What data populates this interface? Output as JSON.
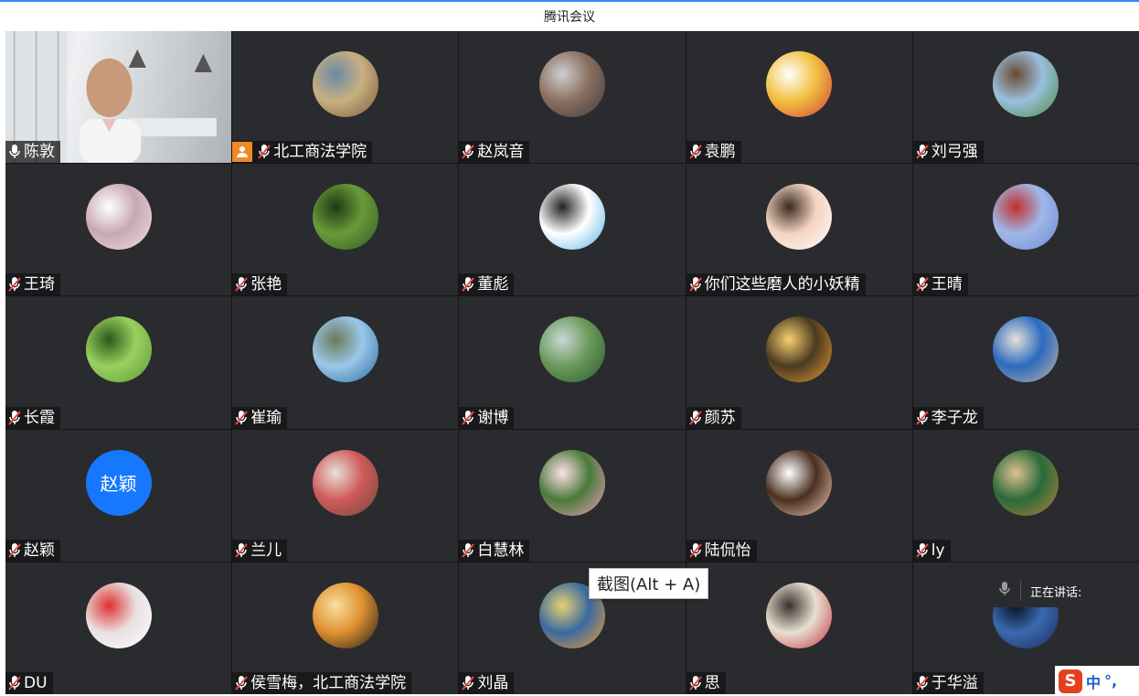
{
  "window": {
    "title": "腾讯会议"
  },
  "participants": [
    {
      "name": "陈敦",
      "kind": "video",
      "mic": "on"
    },
    {
      "name": "北工商法学院",
      "kind": "avatar",
      "host": true,
      "colors": [
        "#7a5a3a",
        "#c8b080",
        "#6a8aa8"
      ]
    },
    {
      "name": "赵岚音",
      "kind": "avatar",
      "colors": [
        "#3a3a3a",
        "#8a7060",
        "#cfcfcf"
      ]
    },
    {
      "name": "袁鹏",
      "kind": "avatar",
      "colors": [
        "#d23a3a",
        "#f2c040",
        "#ffffff"
      ]
    },
    {
      "name": "刘弓强",
      "kind": "avatar",
      "colors": [
        "#4a8a3a",
        "#9ac0e0",
        "#6b4a30"
      ]
    },
    {
      "name": "王琦",
      "kind": "avatar",
      "colors": [
        "#f0e0e4",
        "#c8a8b0",
        "#ffffff"
      ]
    },
    {
      "name": "张艳",
      "kind": "avatar",
      "colors": [
        "#2f5a22",
        "#6a9a3a",
        "#1c3a14"
      ]
    },
    {
      "name": "董彪",
      "kind": "avatar",
      "colors": [
        "#58b0e8",
        "#ffffff",
        "#222222"
      ]
    },
    {
      "name": "你们这些磨人的小妖精",
      "kind": "avatar",
      "colors": [
        "#ffffff",
        "#f4d4c0",
        "#3a2a20"
      ]
    },
    {
      "name": "王晴",
      "kind": "avatar",
      "colors": [
        "#6a8ad0",
        "#a0b8e8",
        "#c03030"
      ]
    },
    {
      "name": "长霞",
      "kind": "avatar",
      "colors": [
        "#5a9a30",
        "#9ad060",
        "#2a5a18"
      ]
    },
    {
      "name": "崔瑜",
      "kind": "avatar",
      "colors": [
        "#2a6aa0",
        "#9ac8e8",
        "#6a7a5a"
      ]
    },
    {
      "name": "谢博",
      "kind": "avatar",
      "colors": [
        "#2a5a30",
        "#6a9a5a",
        "#c8d8d8"
      ]
    },
    {
      "name": "颜苏",
      "kind": "avatar",
      "colors": [
        "#e8a030",
        "#4a3a20",
        "#f8d070"
      ]
    },
    {
      "name": "李子龙",
      "kind": "avatar",
      "colors": [
        "#c8b8a0",
        "#2a6ac0",
        "#e8e0d8"
      ]
    },
    {
      "name": "赵颖",
      "kind": "text",
      "label": "赵颖",
      "colors": [
        "#1677ff"
      ]
    },
    {
      "name": "兰儿",
      "kind": "avatar",
      "colors": [
        "#6a4a3a",
        "#d05a5a",
        "#e8e0d8"
      ]
    },
    {
      "name": "白慧林",
      "kind": "avatar",
      "colors": [
        "#f0a0c0",
        "#4a7a3a",
        "#fce0ea"
      ]
    },
    {
      "name": "陆侃怡",
      "kind": "avatar",
      "colors": [
        "#f4d0b8",
        "#4a3020",
        "#ffffff"
      ]
    },
    {
      "name": "ly",
      "kind": "avatar",
      "colors": [
        "#b88040",
        "#2a6a3a",
        "#e0c090"
      ]
    },
    {
      "name": "DU",
      "kind": "avatar",
      "colors": [
        "#ffffff",
        "#e8e0e0",
        "#e03030"
      ]
    },
    {
      "name": "侯雪梅，北工商法学院",
      "kind": "avatar",
      "colors": [
        "#1a1a1a",
        "#e09030",
        "#f8e0a0"
      ]
    },
    {
      "name": "刘晶",
      "kind": "avatar",
      "colors": [
        "#f0a030",
        "#3a6aa0",
        "#e8d070"
      ]
    },
    {
      "name": "思",
      "kind": "avatar",
      "colors": [
        "#c03040",
        "#e8e0d0",
        "#3a3030"
      ]
    },
    {
      "name": "于华溢",
      "kind": "avatar",
      "colors": [
        "#1a2a5a",
        "#3a6ab0",
        "#0a1020"
      ]
    }
  ],
  "tooltip": {
    "text": "截图(Alt + A)"
  },
  "speaking": {
    "label": "正在讲话:"
  },
  "ime": {
    "logo": "S",
    "mode": "中",
    "punct": "°,"
  },
  "colors": {
    "accent": "#2d8cf0",
    "tile_bg": "#2a2b2e",
    "host_badge": "#f08a24",
    "muted_mic": "#e84a4a"
  }
}
